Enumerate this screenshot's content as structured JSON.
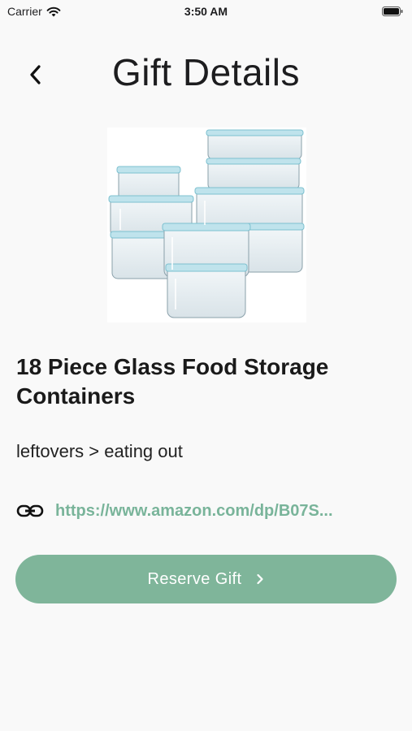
{
  "status_bar": {
    "carrier": "Carrier",
    "time": "3:50 AM"
  },
  "header": {
    "title": "Gift Details",
    "back_icon": "chevron-left-icon"
  },
  "product": {
    "image_description_icon": "glass-food-containers-image",
    "name": "18 Piece Glass Food Storage Containers",
    "note": "leftovers > eating out",
    "link_icon": "link-icon",
    "link_text": "https://www.amazon.com/dp/B07S..."
  },
  "actions": {
    "reserve_label": "Reserve Gift",
    "reserve_icon": "chevron-right-icon"
  },
  "colors": {
    "accent": "#7fb59a",
    "link": "#79b49a",
    "background": "#f9f9f9",
    "text": "#1d1d1f"
  }
}
